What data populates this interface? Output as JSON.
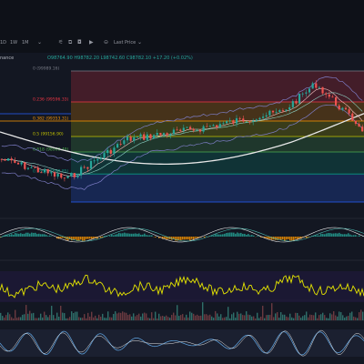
{
  "toolbar": {
    "items": [
      {
        "label": "1D",
        "name": "interval-1d-button"
      },
      {
        "label": "1W",
        "name": "interval-1w-button"
      },
      {
        "label": "1M",
        "name": "interval-1m-button"
      }
    ],
    "icons": [
      {
        "glyph": "⚟",
        "name": "indicators-icon"
      },
      {
        "glyph": "⧉",
        "name": "templates-icon"
      },
      {
        "glyph": "◘",
        "name": "snapshot-icon"
      },
      {
        "glyph": "▶",
        "name": "replay-icon"
      },
      {
        "glyph": "⊝",
        "name": "compare-icon"
      }
    ],
    "price_type_label": "Last Price",
    "price_type_chevron": "⌄"
  },
  "legend": {
    "symbol_fragment": "nance",
    "ohlc": "O98764.90  H98782.20  L98742.60  C98782.10  +17.20 (+0.02%)"
  },
  "fib_levels": [
    {
      "ratio": 0,
      "label": "0 (99989.16)",
      "color": "#787b86"
    },
    {
      "ratio": 0.236,
      "label": "0.236 (99596.33)",
      "color": "#f23645"
    },
    {
      "ratio": 0.382,
      "label": "0.382 (99353.31)",
      "color": "#ff9800"
    },
    {
      "ratio": 0.5,
      "label": "0.5 (99156.90)",
      "color": "#c4c400"
    },
    {
      "ratio": 0.618,
      "label": "0.618 (98960.49)",
      "color": "#4caf50"
    },
    {
      "ratio": 0.786,
      "label": "0.786 (98680.85)",
      "color": "#089981"
    },
    {
      "ratio": 1,
      "label": "",
      "color": "#2962ff"
    }
  ],
  "colors": {
    "background": "#131722",
    "up": "#26a69a",
    "down": "#ef5350",
    "ma_white": "#e8e8e8",
    "ma_blue": "#2962ff",
    "bollinger": "#7e7ec8",
    "oscillator_yellow": "#e6e600",
    "volume": "#2f6f6a",
    "stoch": "#5b9bd5",
    "macd_fill": "#ff9800",
    "separator": "#2a2e39"
  }
}
